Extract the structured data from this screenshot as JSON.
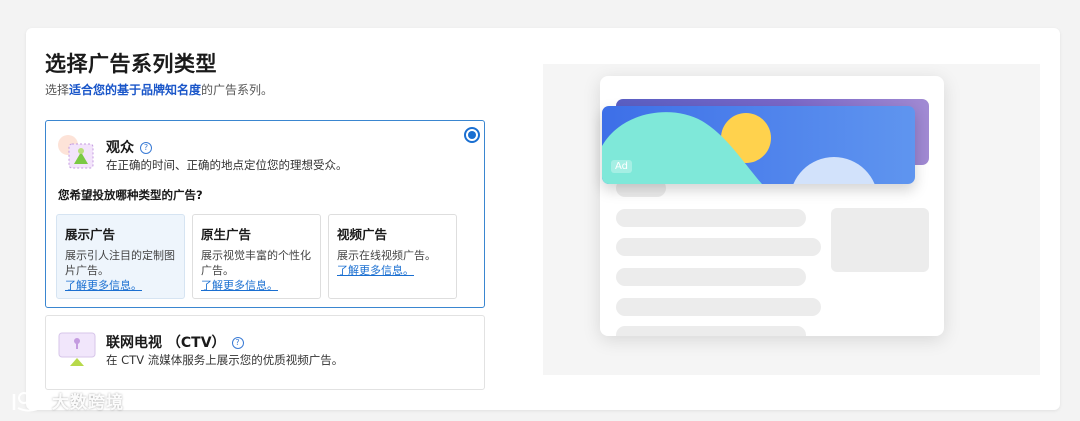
{
  "header": {
    "title": "选择广告系列类型",
    "subtitle_prefix": "选择",
    "subtitle_highlight": "适合您的基于品牌知名度",
    "subtitle_suffix": "的广告系列。"
  },
  "options": [
    {
      "title": "观众",
      "help": "?",
      "desc": "在正确的时间、正确的地点定位您的理想受众。",
      "selected": true,
      "question": "您希望投放哪种类型的广告?",
      "types": [
        {
          "title": "展示广告",
          "desc": "展示引人注目的定制图片广告。",
          "link": "了解更多信息。",
          "selected": true
        },
        {
          "title": "原生广告",
          "desc": "展示视觉丰富的个性化广告。",
          "link": "了解更多信息。",
          "selected": false
        },
        {
          "title": "视频广告",
          "desc": "展示在线视频广告。",
          "link": "了解更多信息。",
          "selected": false
        }
      ]
    },
    {
      "title": "联网电视 （CTV）",
      "help": "?",
      "desc": "在 CTV 流媒体服务上展示您的优质视频广告。",
      "selected": false
    }
  ],
  "preview": {
    "ad_badge": "Ad"
  },
  "watermark": "大数跨境",
  "colors": {
    "accent": "#1a6fd1",
    "highlight": "#1a56c9",
    "banner_top": "#5a5fc4",
    "banner_front": "#3d6fe8",
    "wave": "#7fe8d9",
    "sun": "#ffd24d"
  }
}
